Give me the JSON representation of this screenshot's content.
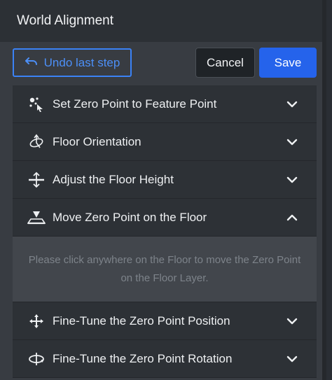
{
  "header": {
    "title": "World Alignment"
  },
  "toolbar": {
    "undo_label": "Undo last step",
    "cancel_label": "Cancel",
    "save_label": "Save"
  },
  "accordion": {
    "items": [
      {
        "label": "Set Zero Point to Feature Point",
        "icon": "feature-point-icon",
        "expanded": false
      },
      {
        "label": "Floor Orientation",
        "icon": "floor-orientation-icon",
        "expanded": false
      },
      {
        "label": "Adjust the Floor Height",
        "icon": "floor-height-icon",
        "expanded": false
      },
      {
        "label": "Move Zero Point on the Floor",
        "icon": "zero-point-floor-icon",
        "expanded": true,
        "body": "Please click anywhere on the Floor to move the Zero Point on the Floor Layer."
      },
      {
        "label": "Fine-Tune the Zero Point Position",
        "icon": "move-arrows-icon",
        "expanded": false
      },
      {
        "label": "Fine-Tune the Zero Point Rotation",
        "icon": "rotate-icon",
        "expanded": false
      }
    ]
  },
  "colors": {
    "accent": "#2563eb",
    "accent_outline": "#3b82f6",
    "panel": "#383c42",
    "header": "#2c3035"
  }
}
